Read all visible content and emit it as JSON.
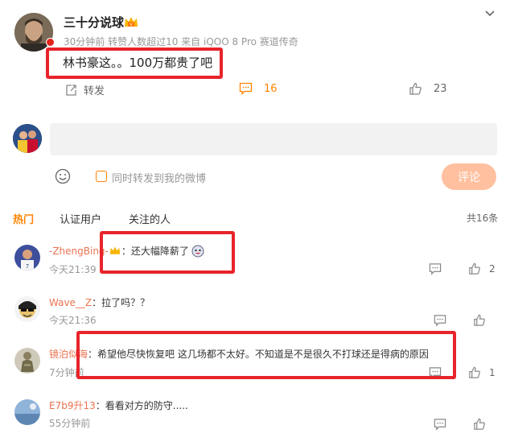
{
  "post": {
    "username": "三十分说球",
    "meta": "30分钟前 转赞人数超过10 来自 iQOO 8 Pro 赛道传奇",
    "text": "林书豪这。。100万都贵了吧",
    "share_label": "转发",
    "comment_count": "16",
    "like_count": "23"
  },
  "composer": {
    "checkbox_label": "同时转发到我的微博",
    "submit_label": "评论"
  },
  "tabs": [
    "热门",
    "认证用户",
    "关注的人"
  ],
  "total": "共16条",
  "comments": [
    {
      "name": "-ZhengBing-",
      "text": "：还大幅降薪了",
      "time": "今天21:39",
      "likes": "2"
    },
    {
      "name": "Wave__Z",
      "text": "：拉了吗？？",
      "time": "今天21:36",
      "likes": ""
    },
    {
      "name": "镜泊似海",
      "text": "：希望他尽快恢复吧 这几场都不太好。不知道是不是很久不打球还是得病的原因",
      "time": "7分钟前",
      "likes": "1"
    },
    {
      "name": "E7b9升13",
      "text": "：看看对方的防守.....",
      "time": "55分钟前",
      "likes": ""
    }
  ],
  "colors": {
    "accent": "#ff8200",
    "name_color": "#eb7350",
    "highlight": "#e8242b"
  }
}
